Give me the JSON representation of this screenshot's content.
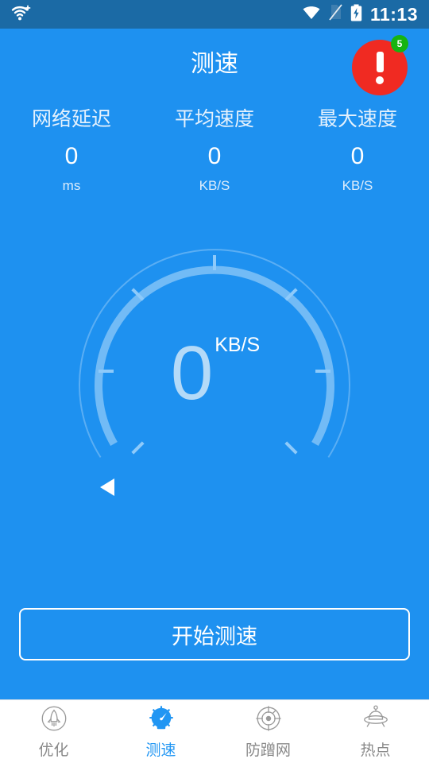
{
  "status_bar": {
    "left_icons": [
      {
        "name": "wifi-plus-icon",
        "glyph": "wifi+"
      }
    ],
    "right_icons": [
      {
        "name": "wifi-icon",
        "glyph": "wifi"
      },
      {
        "name": "no-sim-icon",
        "glyph": "sim-off"
      },
      {
        "name": "battery-charging-icon",
        "glyph": "battery"
      }
    ],
    "time": "11:13"
  },
  "header": {
    "title": "测速",
    "alert": {
      "name": "alert-icon",
      "badge_count": "5",
      "circle_color": "#f02a22",
      "badge_color": "#16b411"
    }
  },
  "stats": [
    {
      "label": "网络延迟",
      "value": "0",
      "unit": "ms"
    },
    {
      "label": "平均速度",
      "value": "0",
      "unit": "KB/S"
    },
    {
      "label": "最大速度",
      "value": "0",
      "unit": "KB/S"
    }
  ],
  "gauge": {
    "value": "0",
    "unit": "KB/S",
    "arc_color": "#64b5f6",
    "ring_color": "#77bdf7",
    "pointer_color": "#ffffff",
    "value_color": "#b4daf8"
  },
  "primary_button": {
    "label": "开始测速"
  },
  "bottom_nav": {
    "active_index": 1,
    "accent_color": "#2196f3",
    "inactive_color": "#8a8a8a",
    "items": [
      {
        "label": "优化",
        "icon": "rocket-icon"
      },
      {
        "label": "测速",
        "icon": "speedometer-icon"
      },
      {
        "label": "防蹭网",
        "icon": "radar-target-icon"
      },
      {
        "label": "热点",
        "icon": "hotspot-ufo-icon"
      }
    ]
  },
  "theme": {
    "background": "#1e91f0",
    "status_bar_background": "#1b6aa5",
    "nav_background": "#ffffff"
  }
}
